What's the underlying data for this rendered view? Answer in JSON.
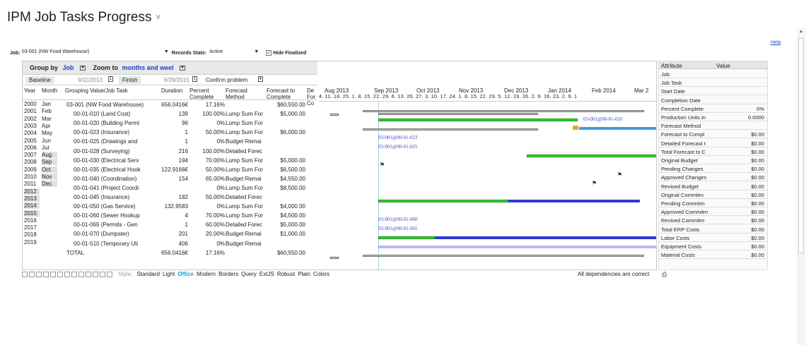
{
  "page": {
    "title": "IPM Job Tasks Progress",
    "title_chevron": "˅",
    "help": "Help"
  },
  "filters": {
    "job_label": "Job:",
    "job_value": "03-001 (NW Food Warehouse)",
    "state_label": "Records State:",
    "state_value": "Active",
    "hide_finalized": "Hide Finalized"
  },
  "toolbar": {
    "group_by_label": "Group by",
    "group_by_value": "Job",
    "zoom_label": "Zoom to",
    "zoom_value": "months and weel",
    "baseline_label": "Baseline",
    "baseline_value": "9/11/2013",
    "finish_label": "Finish",
    "finish_value": "6/29/2015",
    "confirm_label": "Confirm problem"
  },
  "columns": {
    "year": "Year",
    "month": "Month",
    "task": "Grouping Value/Job Task",
    "duration": "Duration",
    "percent": "Percent Complete",
    "method": "Forecast Method",
    "forecast": "Forecast to Complete",
    "de": "De For Co"
  },
  "years": [
    "2000",
    "2001",
    "2002",
    "2003",
    "2004",
    "2005",
    "2006",
    "2007",
    "2008",
    "2009",
    "2010",
    "2011",
    "2012",
    "2013",
    "2014",
    "2015",
    "2016",
    "2017",
    "2018",
    "2019"
  ],
  "months": [
    "Jan",
    "Feb",
    "Mar",
    "Apr",
    "May",
    "Jun",
    "Jul",
    "Aug",
    "Sep",
    "Oct",
    "Nov",
    "Dec"
  ],
  "rows": [
    {
      "task": "03-001 (NW Food Warehouse)",
      "duration": "656.0416€",
      "percent": "17.16%",
      "method": "",
      "forecast": "$60,550.00"
    },
    {
      "task": "00-01-010 (Land Cost)",
      "duration": "139",
      "percent": "100.00%",
      "method": "Lump Sum For",
      "forecast": "$5,000.00"
    },
    {
      "task": "00-01-020 (Building Permi",
      "duration": "96",
      "percent": "0%",
      "method": "Lump Sum For",
      "forecast": ""
    },
    {
      "task": "00-01-023 (Insurance)",
      "duration": "1",
      "percent": "50.00%",
      "method": "Lump Sum For",
      "forecast": "$6,000.00"
    },
    {
      "task": "00-01-025 (Drawings and",
      "duration": "1",
      "percent": "0%",
      "method": "Budget Remai",
      "forecast": ""
    },
    {
      "task": "00-01-028 (Surveying)",
      "duration": "216",
      "percent": "100.00%",
      "method": "Detailed Forec",
      "forecast": ""
    },
    {
      "task": "00-01-030 (Electrical Serv",
      "duration": "194",
      "percent": "70.00%",
      "method": "Lump Sum For",
      "forecast": "$5,000.00"
    },
    {
      "task": "00-01-035 (Electrical Hook",
      "duration": "122.9166€",
      "percent": "50.00%",
      "method": "Lump Sum For",
      "forecast": "$6,500.00"
    },
    {
      "task": "00-01-040 (Coordination)",
      "duration": "154",
      "percent": "65.00%",
      "method": "Budget Remai",
      "forecast": "$4,550.00"
    },
    {
      "task": "00-01-041 (Project Coordi",
      "duration": "",
      "percent": "0%",
      "method": "Lump Sum For",
      "forecast": "$8,500.00"
    },
    {
      "task": "00-01-045 (Insurance)",
      "duration": "182",
      "percent": "50.00%",
      "method": "Detailed Forec",
      "forecast": ""
    },
    {
      "task": "00-01-050 (Gas Service)",
      "duration": "132.9583",
      "percent": "0%",
      "method": "Lump Sum For",
      "forecast": "$4,000.00"
    },
    {
      "task": "00-01-060 (Sewer Hookup",
      "duration": "4",
      "percent": "70.00%",
      "method": "Lump Sum For",
      "forecast": "$4,500.00"
    },
    {
      "task": "00-01-065 (Permits - Gen",
      "duration": "1",
      "percent": "60.00%",
      "method": "Detailed Forec",
      "forecast": "$5,000.00"
    },
    {
      "task": "00-01-070 (Dumpster)",
      "duration": "201",
      "percent": "20.00%",
      "method": "Budget Remai",
      "forecast": "$1,000.00"
    },
    {
      "task": "00-01-510 (Temporary Uti",
      "duration": "406",
      "percent": "0%",
      "method": "Budget Remai",
      "forecast": ""
    }
  ],
  "total": {
    "label": "TOTAL",
    "duration": "656.0416€",
    "percent": "17.16%",
    "forecast": "$60,550.00"
  },
  "gantt": {
    "months": [
      "Aug 2013",
      "Sep 2013",
      "Oct 2013",
      "Nov 2013",
      "Dec 2013",
      "Jan 2014",
      "Feb 2014",
      "Mar 2"
    ],
    "days": "4. 11. 18. 25. 1. 8. 15. 22. 29. 6. 13. 20. 27. 3. 10. 17. 24. 1. 8. 15. 22. 29. 5. 12. 19. 26. 2. 9. 16. 23. 2. 9. 1",
    "labels": [
      "03-001@00-01-010",
      "03-001@00-01-023",
      "03-001@00-01-025",
      "03-001@00-01-060",
      "03-001@00-01-065"
    ]
  },
  "attributes": {
    "headers": [
      "Attribute",
      "Value"
    ],
    "rows": [
      [
        "Job",
        ""
      ],
      [
        "Job Task",
        ""
      ],
      [
        "Start Date",
        ""
      ],
      [
        "Completion Date",
        ""
      ],
      [
        "Percent Complete",
        "0%"
      ],
      [
        "Production Units in",
        "0.0000"
      ],
      [
        "Forecast Method",
        ""
      ],
      [
        "Forecast to Compl",
        "$0.00"
      ],
      [
        "Detailed Forecast t",
        "$0.00"
      ],
      [
        "Total Forecast to C",
        "$0.00"
      ],
      [
        "Original Budget",
        "$0.00"
      ],
      [
        "Pending Changes",
        "$0.00"
      ],
      [
        "Approved Changes",
        "$0.00"
      ],
      [
        "Revised Budget",
        "$0.00"
      ],
      [
        "Original Commitm",
        "$0.00"
      ],
      [
        "Pending Commitm",
        "$0.00"
      ],
      [
        "Approved Commitm",
        "$0.00"
      ],
      [
        "Revised Commitm",
        "$0.00"
      ],
      [
        "Total ERP Costs",
        "$0.00"
      ],
      [
        "Labor Costs",
        "$0.00"
      ],
      [
        "Equipment Costs",
        "$0.00"
      ],
      [
        "Material Costs",
        "$0.00"
      ]
    ]
  },
  "bottom": {
    "style_label": "Style:",
    "styles": [
      "Standard",
      "Light",
      "Office",
      "Modern",
      "Borders",
      "Query",
      "ExtJS",
      "Robust",
      "Plain",
      "Colors"
    ],
    "status": "All dependencies are correct"
  }
}
